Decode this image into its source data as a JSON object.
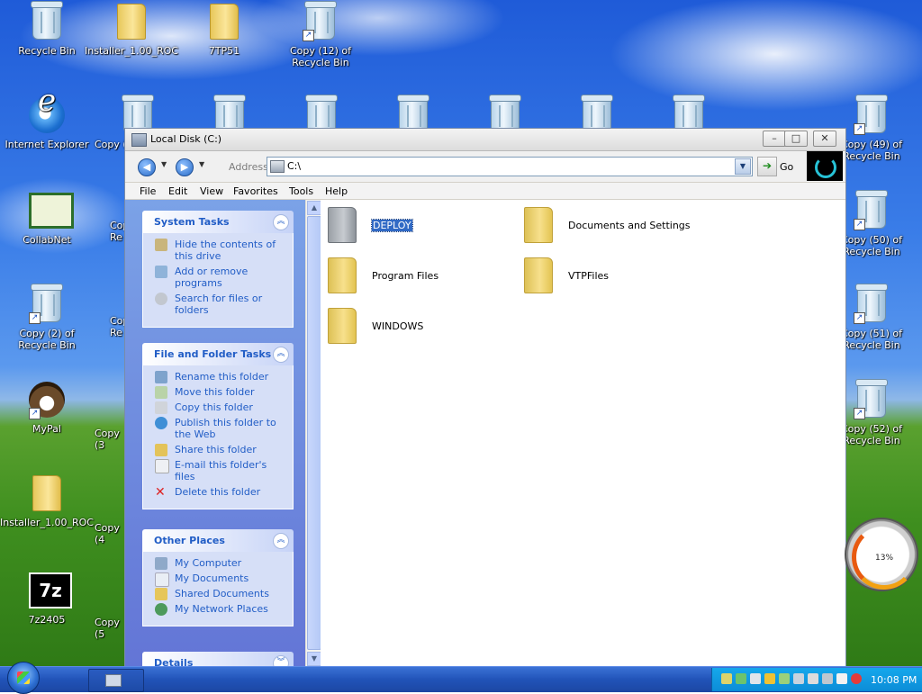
{
  "desktop": {
    "icons": [
      {
        "label": "Recycle Bin"
      },
      {
        "label": "Installer_1.00_ROC"
      },
      {
        "label": "7TP51"
      },
      {
        "label": "Copy (12) of Recycle Bin"
      },
      {
        "label": "Internet Explorer"
      },
      {
        "label": "CollabNet"
      },
      {
        "label": "Copy (2) of Recycle Bin"
      },
      {
        "label": "MyPal"
      },
      {
        "label": "Installer_1.00_ROC"
      },
      {
        "label": "7z2405"
      },
      {
        "label": "Copy (49) of Recycle Bin"
      },
      {
        "label": "Copy (50) of Recycle Bin"
      },
      {
        "label": "Copy (51) of Recycle Bin"
      },
      {
        "label": "Copy (52) of Recycle Bin"
      }
    ],
    "partial_labels": [
      "Copy (",
      "Cop",
      "Re",
      "Cop",
      "Re",
      "Copy (3",
      "Copy (4",
      "Copy (5"
    ]
  },
  "window": {
    "title": "Local Disk (C:)",
    "controls": {
      "minimize": "–",
      "maximize": "□",
      "close": "✕"
    },
    "address_label": "Address",
    "address_value": "C:\\",
    "go_label": "Go",
    "menu": [
      "File",
      "Edit",
      "View",
      "Favorites",
      "Tools",
      "Help"
    ]
  },
  "taskpane": {
    "system_tasks": {
      "title": "System Tasks",
      "items": [
        "Hide the contents of this drive",
        "Add or remove programs",
        "Search for files or folders"
      ]
    },
    "file_folder_tasks": {
      "title": "File and Folder Tasks",
      "items": [
        "Rename this folder",
        "Move this folder",
        "Copy this folder",
        "Publish this folder to the Web",
        "Share this folder",
        "E-mail this folder's files",
        "Delete this folder"
      ]
    },
    "other_places": {
      "title": "Other Places",
      "items": [
        "My Computer",
        "My Documents",
        "Shared Documents",
        "My Network Places"
      ]
    },
    "details": {
      "title": "Details"
    }
  },
  "folders": [
    {
      "name": "DEPLOY",
      "selected": true
    },
    {
      "name": "Documents and Settings",
      "selected": false
    },
    {
      "name": "Program Files",
      "selected": false
    },
    {
      "name": "VTPFiles",
      "selected": false
    },
    {
      "name": "WINDOWS",
      "selected": false
    }
  ],
  "gadget": {
    "percent": "13%"
  },
  "taskbar": {
    "clock": "10:08 PM"
  },
  "colors": {
    "taskpane_link": "#215dc6",
    "selection": "#316ac5",
    "taskbar": "#2153b8",
    "tray": "#0c8cd7"
  }
}
